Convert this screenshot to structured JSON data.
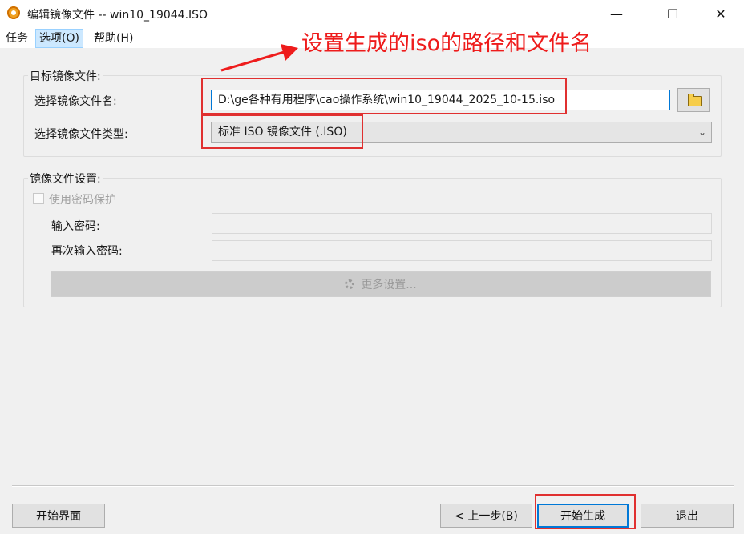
{
  "window": {
    "title": "编辑镜像文件 -- win10_19044.ISO",
    "minimize_glyph": "—",
    "maximize_glyph": "☐",
    "close_glyph": "✕"
  },
  "menu": {
    "items": [
      "任务",
      "选项(O)",
      "帮助(H)"
    ]
  },
  "annotation": {
    "text": "设置生成的iso的路径和文件名",
    "color": "#ee1c1c"
  },
  "target_group": {
    "label": "目标镜像文件:",
    "filename_label": "选择镜像文件名:",
    "filename_value": "D:\\ge各种有用程序\\cao操作系统\\win10_19044_2025_10-15.iso",
    "browse_icon": "folder-icon",
    "type_label": "选择镜像文件类型:",
    "type_value": "标准 ISO 镜像文件 (.ISO)"
  },
  "settings_group": {
    "label": "镜像文件设置:",
    "password_checkbox_label": "使用密码保护",
    "password_checked": false,
    "password_label": "输入密码:",
    "password_value": "",
    "confirm_label": "再次输入密码:",
    "confirm_value": "",
    "more_settings_label": "更多设置..."
  },
  "footer": {
    "home_button": "开始界面",
    "back_button": "< 上一步(B)",
    "start_button": "开始生成",
    "exit_button": "退出"
  },
  "colors": {
    "accent": "#0078d7",
    "highlight_box": "#e03030",
    "menu_active": "#cce8ff"
  }
}
